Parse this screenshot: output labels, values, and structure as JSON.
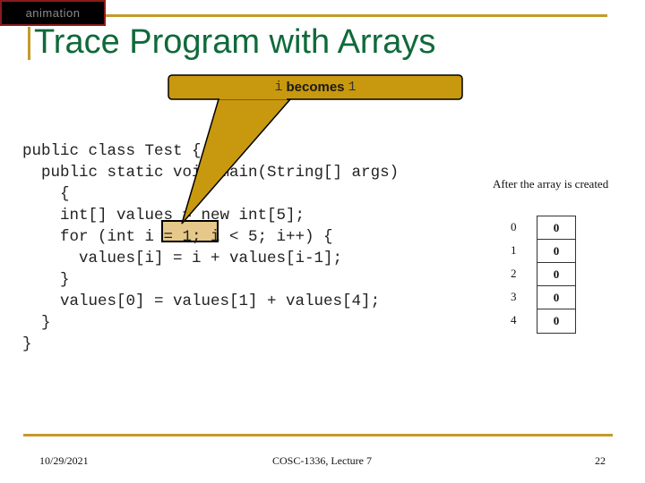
{
  "badge": {
    "label": "animation"
  },
  "slide": {
    "title": "Trace Program with Arrays"
  },
  "callout": {
    "var": "i",
    "text": "becomes",
    "value": "1",
    "fill_color": "#c8980e"
  },
  "code": {
    "lines": [
      "public class Test {",
      "  public static void main(String[] args)",
      "    {",
      "    int[] values = new int[5];",
      "    for (int i = 1; i < 5; i++) {",
      "      values[i] = i + values[i-1];",
      "    }",
      "    values[0] = values[1] + values[4];",
      "  }",
      "}"
    ],
    "highlight": "i = 1"
  },
  "array_diagram": {
    "caption": "After the array is created",
    "indices": [
      "0",
      "1",
      "2",
      "3",
      "4"
    ],
    "values": [
      "0",
      "0",
      "0",
      "0",
      "0"
    ]
  },
  "footer": {
    "date": "10/29/2021",
    "course": "COSC-1336, Lecture 7",
    "page": "22"
  },
  "colors": {
    "accent_gold": "#c49a2a",
    "title_green": "#0f6a3a",
    "highlight_fill": "#e6c98a"
  }
}
